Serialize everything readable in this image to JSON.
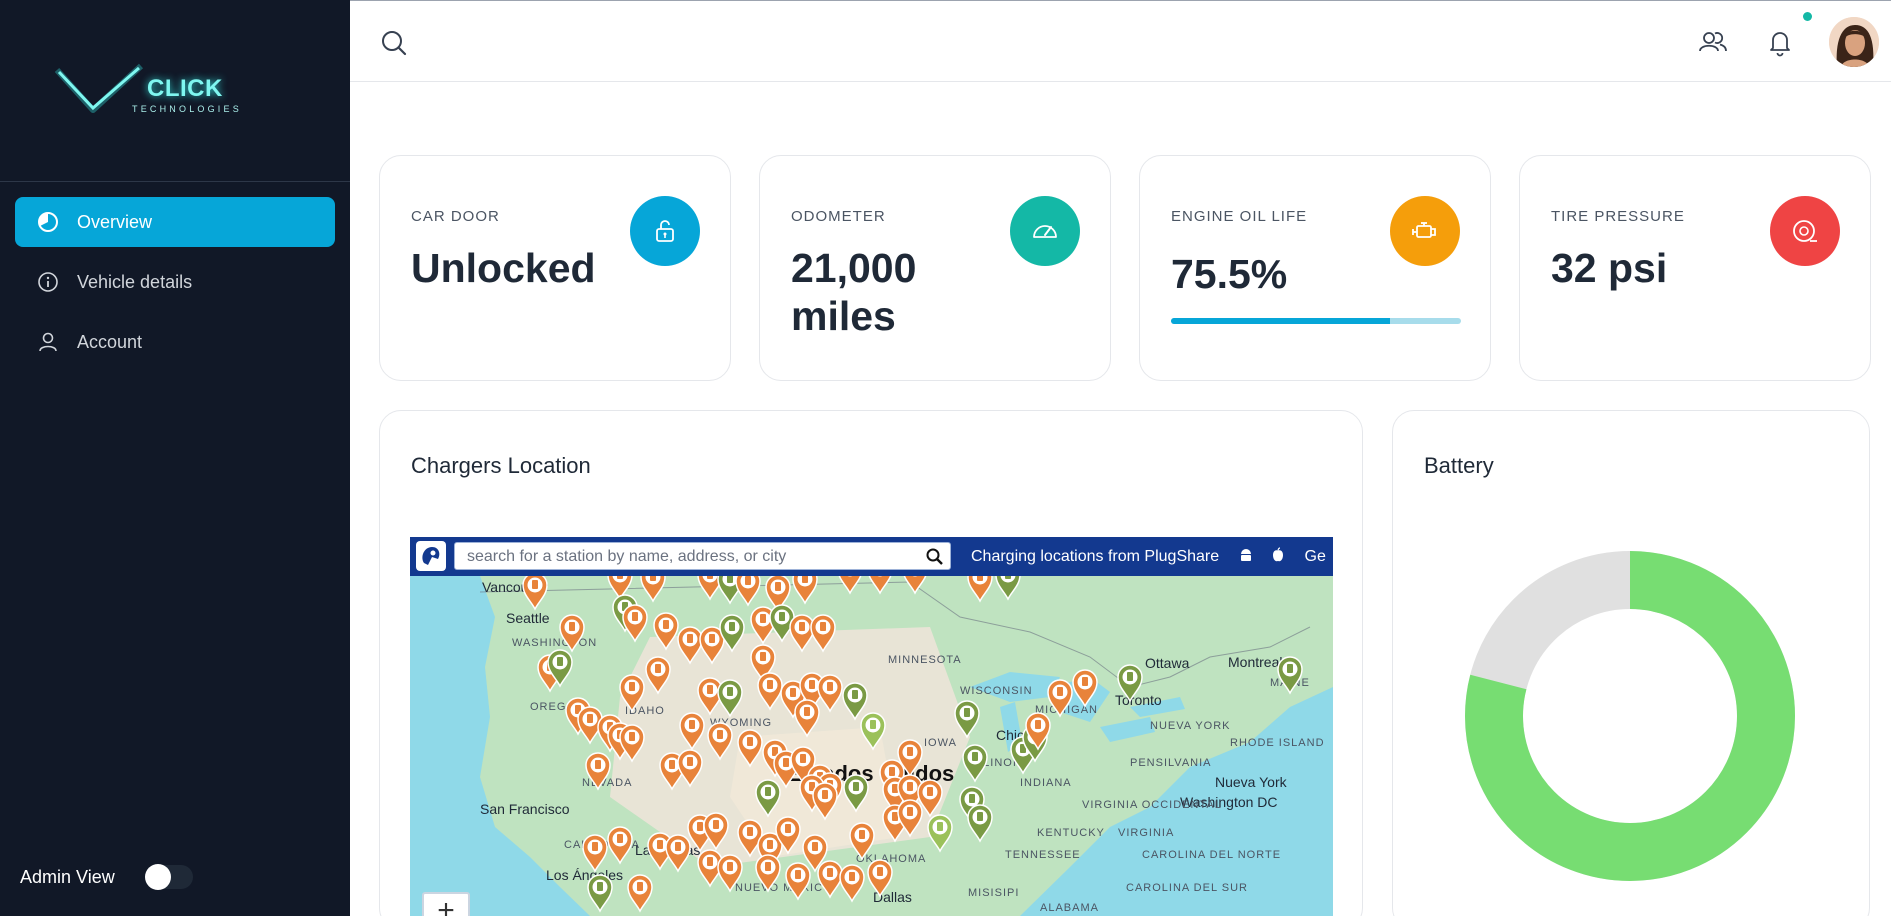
{
  "brand": {
    "name": "CLICK",
    "subtitle": "TECHNOLOGIES",
    "accent": "#33e6e0"
  },
  "sidebar": {
    "items": [
      {
        "label": "Overview",
        "icon": "pie-chart-icon",
        "active": true
      },
      {
        "label": "Vehicle details",
        "icon": "info-icon",
        "active": false
      },
      {
        "label": "Account",
        "icon": "user-icon",
        "active": false
      }
    ],
    "admin_label": "Admin View",
    "admin_enabled": false
  },
  "header": {
    "icons": [
      "search-icon",
      "users-icon",
      "bell-icon"
    ],
    "notification_dot": true
  },
  "cards": [
    {
      "label": "CAR DOOR",
      "value": "Unlocked",
      "icon": "lock-icon",
      "color": "#06a6d8"
    },
    {
      "label": "ODOMETER",
      "value": "21,000 miles",
      "icon": "speedometer-icon",
      "color": "#14b8a6"
    },
    {
      "label": "ENGINE OIL LIFE",
      "value": "75.5%",
      "icon": "engine-icon",
      "color": "#f59e0b",
      "progress": 0.755
    },
    {
      "label": "TIRE PRESSURE",
      "value": "32 psi",
      "icon": "tire-icon",
      "color": "#ef4444"
    }
  ],
  "chargers": {
    "title": "Chargers Location",
    "search_placeholder": "search for a station by name, address, or city",
    "bar_text": "Charging locations from PlugShare",
    "bar_extra": "Ge",
    "zoom_in": "+",
    "labels": [
      "Vancouver",
      "Seattle",
      "WASHINGTON",
      "OREGON",
      "IDAHO",
      "WYOMING",
      "NEVADA",
      "San Francisco",
      "CALIFORNIA",
      "Las Vegas",
      "Los Ángeles",
      "MINNESOTA",
      "WISCONSIN",
      "MICHIGAN",
      "Chicago",
      "IOWA",
      "ILLINOIS",
      "INDIANA",
      "Ottawa",
      "Montreal",
      "Toronto",
      "MAINE",
      "NUEVA YORK",
      "RHODE ISLAND",
      "PENSILVANIA",
      "Nueva York",
      "Washington DC",
      "VIRGINIA OCCIDENTAL",
      "VIRGINIA",
      "KENTUCKY",
      "TENNESSEE",
      "CAROLINA DEL NORTE",
      "CAROLINA DEL SUR",
      "OKLAHOMA",
      "Dallas",
      "MISISIPI",
      "ALABAMA",
      "NUEVO MÉXICO",
      "Estados Unidos"
    ]
  },
  "battery": {
    "title": "Battery",
    "level": 0.79,
    "fill_color": "#77dd72",
    "empty_color": "#e0e0e0"
  }
}
